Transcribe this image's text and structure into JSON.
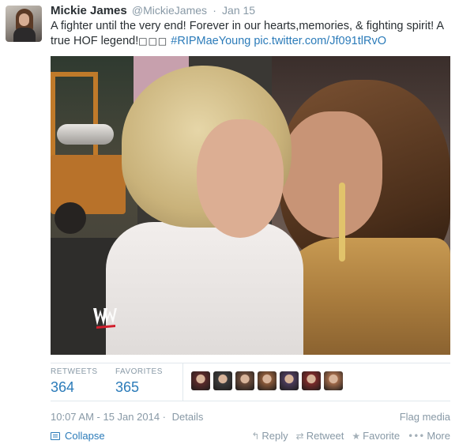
{
  "tweet": {
    "fullname": "Mickie James",
    "username": "@MickieJames",
    "separator": "·",
    "time": "Jan 15",
    "text_main": "A fighter until the very end! Forever in our hearts,memories, & fighting spirit! A true HOF legend!",
    "text_boxes": "□□□",
    "hashtag": "#RIPMaeYoung",
    "link": "pic.twitter.com/Jf091tlRvO"
  },
  "stats": {
    "retweets_label": "RETWEETS",
    "retweets_value": "364",
    "favorites_label": "FAVORITES",
    "favorites_value": "365",
    "avatars": [
      {
        "color": "#5a2a2a"
      },
      {
        "color": "#3b3b3b"
      },
      {
        "color": "#6a4b3a"
      },
      {
        "color": "#8a5a3a"
      },
      {
        "color": "#4a3a5a"
      },
      {
        "color": "#7a2a2a"
      },
      {
        "color": "#a06a4a"
      }
    ]
  },
  "meta": {
    "timestamp": "10:07 AM - 15 Jan 2014",
    "separator": "·",
    "details": "Details",
    "flag_media": "Flag media"
  },
  "actions": {
    "collapse": "Collapse",
    "reply": "Reply",
    "retweet": "Retweet",
    "favorite": "Favorite",
    "more": "More"
  },
  "icons": {
    "reply": "reply-icon",
    "retweet": "retweet-icon",
    "favorite": "star-icon",
    "more": "more-icon",
    "collapse": "collapse-icon"
  },
  "colors": {
    "link": "#2b7bb9",
    "muted": "#8899a6",
    "text": "#292f33"
  }
}
